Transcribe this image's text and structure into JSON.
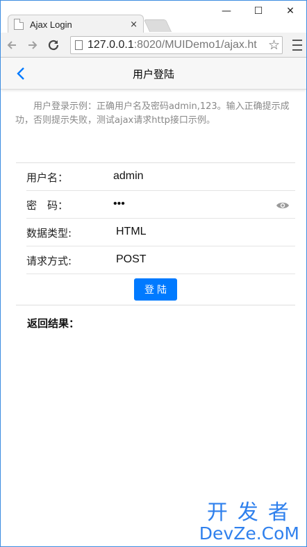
{
  "browser": {
    "tab_title": "Ajax Login",
    "tab_close": "×",
    "url_host": "127.0.0.1",
    "url_rest": ":8020/MUIDemo1/ajax.ht"
  },
  "window": {
    "minimize": "—",
    "maximize": "☐",
    "close": "✕"
  },
  "header": {
    "title": "用户登陆"
  },
  "intro_text": "用户登录示例：正确用户名及密码admin,123。输入正确提示成功，否则提示失败，测试ajax请求http接口示例。",
  "form": {
    "username_label": "用户名：",
    "username_value": "admin",
    "password_label": "密　码：",
    "password_value": "•••",
    "datatype_label": "数据类型:",
    "datatype_value": "HTML",
    "method_label": "请求方式:",
    "method_value": "POST",
    "login_button": "登陆"
  },
  "result_label": "返回结果：",
  "watermark": {
    "line1": "开发者",
    "line2": "DevZe.CoM"
  },
  "colors": {
    "accent": "#007aff",
    "window_border": "#3c8ce0",
    "watermark": "#2f80ed"
  }
}
